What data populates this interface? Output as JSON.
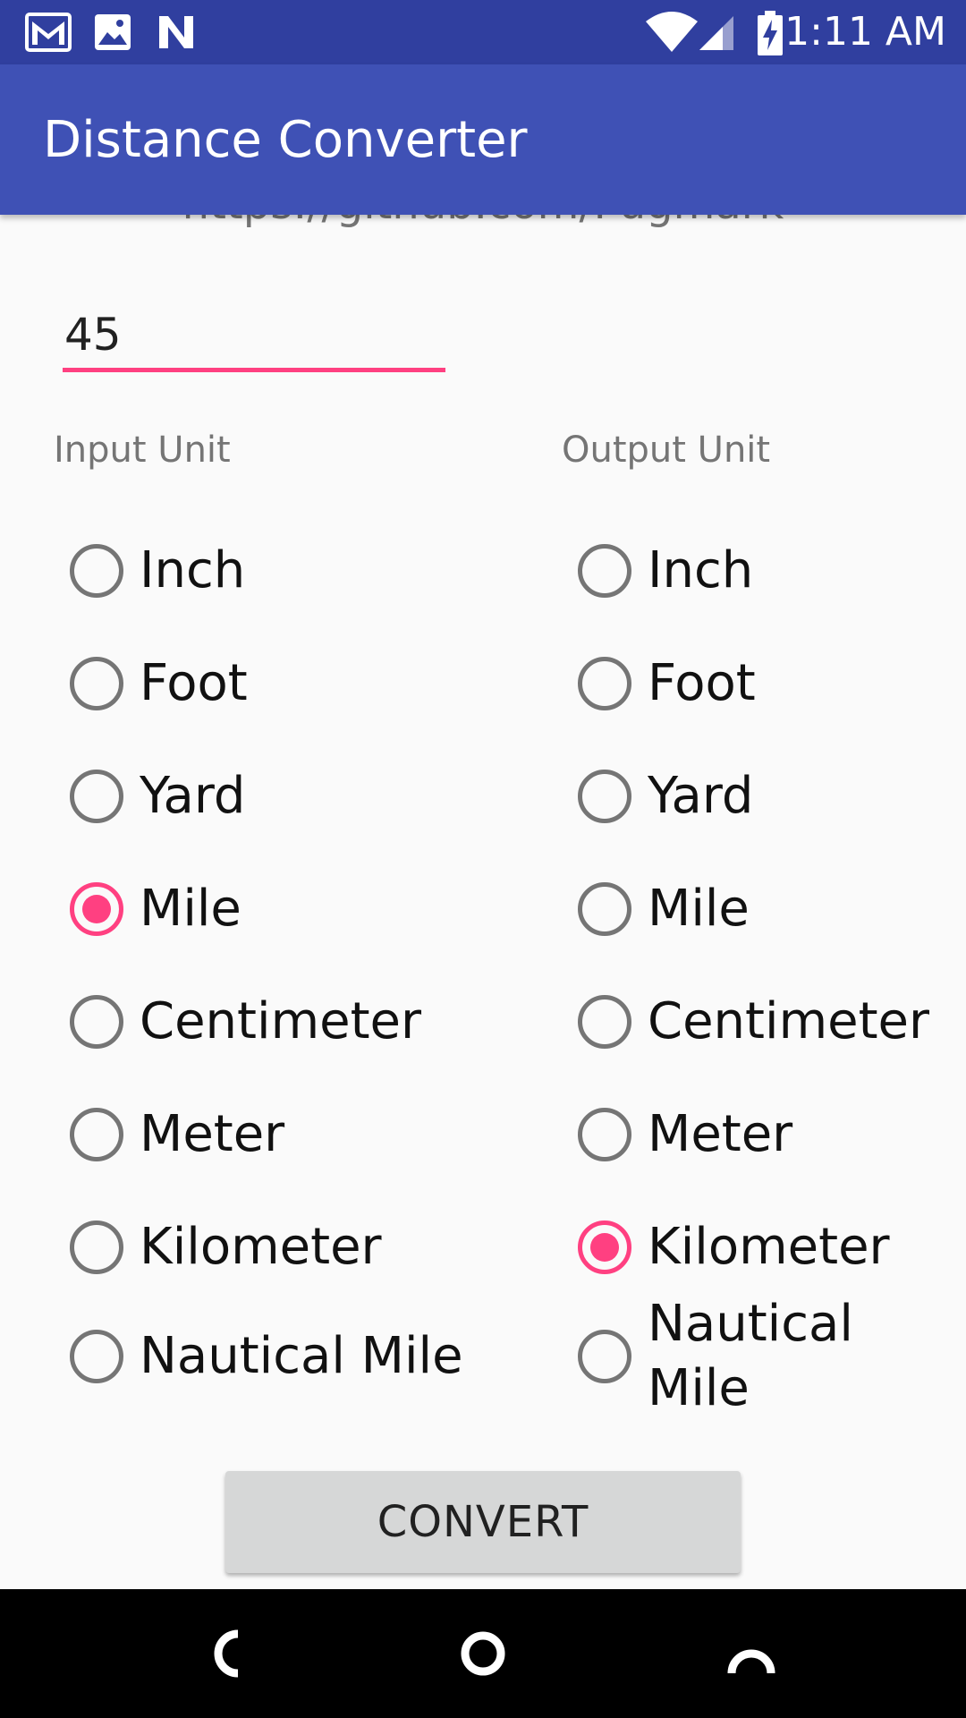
{
  "status_bar": {
    "time": "1:11 AM",
    "left_icons": [
      "gmail-icon",
      "image-icon",
      "n-notification-icon"
    ],
    "right_icons": [
      "wifi-icon",
      "cell-signal-icon",
      "battery-charging-icon"
    ]
  },
  "app_bar": {
    "title": "Distance Converter"
  },
  "content": {
    "peek_text": "https://github.com/Pugmark",
    "input_value": "45",
    "input_label": "Input Unit",
    "output_label": "Output Unit",
    "input_units": [
      {
        "label": "Inch",
        "checked": false
      },
      {
        "label": "Foot",
        "checked": false
      },
      {
        "label": "Yard",
        "checked": false
      },
      {
        "label": "Mile",
        "checked": true
      },
      {
        "label": "Centimeter",
        "checked": false
      },
      {
        "label": "Meter",
        "checked": false
      },
      {
        "label": "Kilometer",
        "checked": false
      },
      {
        "label": "Nautical Mile",
        "checked": false
      }
    ],
    "output_units": [
      {
        "label": "Inch",
        "checked": false
      },
      {
        "label": "Foot",
        "checked": false
      },
      {
        "label": "Yard",
        "checked": false
      },
      {
        "label": "Mile",
        "checked": false
      },
      {
        "label": "Centimeter",
        "checked": false
      },
      {
        "label": "Meter",
        "checked": false
      },
      {
        "label": "Kilometer",
        "checked": true
      },
      {
        "label": "Nautical Mile",
        "checked": false
      }
    ],
    "convert_label": "CONVERT"
  },
  "colors": {
    "status_bar": "#303f9f",
    "app_bar": "#3f51b5",
    "accent": "#ff4081",
    "button": "#d6d7d7"
  }
}
